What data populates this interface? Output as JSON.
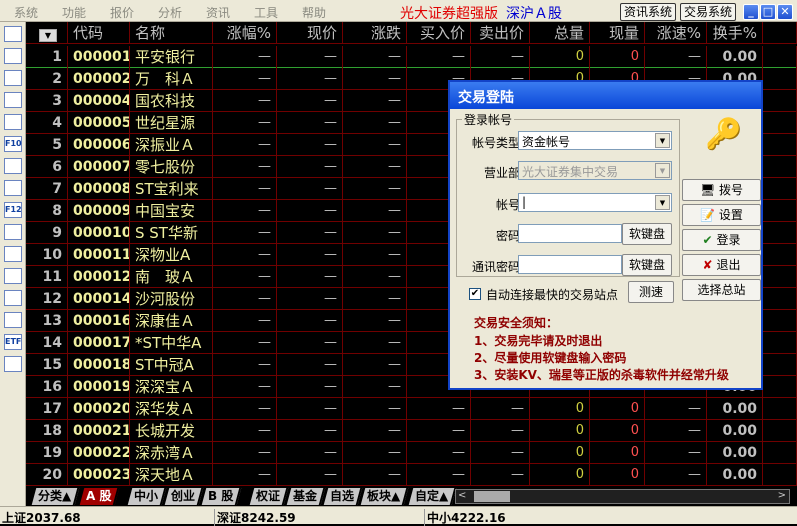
{
  "menu": [
    "系统",
    "功能",
    "报价",
    "分析",
    "资讯",
    "工具",
    "帮助"
  ],
  "title": "光大证券超强版",
  "market": "深沪Ａ股",
  "buttons": {
    "info": "资讯系统",
    "trade": "交易系统"
  },
  "headers": [
    "代码",
    "名称",
    "涨幅%",
    "现价",
    "涨跌",
    "买入价",
    "卖出价",
    "总量",
    "现量",
    "涨速%",
    "换手%"
  ],
  "dash": "—",
  "rows": [
    [
      "1",
      "000001",
      "平安银行"
    ],
    [
      "2",
      "000002",
      "万　科Ａ"
    ],
    [
      "3",
      "000004",
      "国农科技"
    ],
    [
      "4",
      "000005",
      "世纪星源"
    ],
    [
      "5",
      "000006",
      "深振业Ａ"
    ],
    [
      "6",
      "000007",
      "零七股份"
    ],
    [
      "7",
      "000008",
      "ST宝利来"
    ],
    [
      "8",
      "000009",
      "中国宝安"
    ],
    [
      "9",
      "000010",
      "S ST华新"
    ],
    [
      "10",
      "000011",
      "深物业A"
    ],
    [
      "11",
      "000012",
      "南　玻Ａ"
    ],
    [
      "12",
      "000014",
      "沙河股份"
    ],
    [
      "13",
      "000016",
      "深康佳Ａ"
    ],
    [
      "14",
      "000017",
      "*ST中华A"
    ],
    [
      "15",
      "000018",
      "ST中冠A"
    ],
    [
      "16",
      "000019",
      "深深宝Ａ"
    ],
    [
      "17",
      "000020",
      "深华发Ａ"
    ],
    [
      "18",
      "000021",
      "长城开发"
    ],
    [
      "19",
      "000022",
      "深赤湾Ａ"
    ],
    [
      "20",
      "000023",
      "深天地Ａ"
    ]
  ],
  "zero": "0",
  "turnover": "0.00",
  "tabs": [
    "分类▲",
    "A 股",
    "中小",
    "创业",
    "B 股",
    "权证",
    "基金",
    "自选",
    "板块▲",
    "自定▲"
  ],
  "status": {
    "sh": "上证2037.68",
    "sz": "深证8242.59",
    "zx": "中小4222.16"
  },
  "dialog": {
    "title": "交易登陆",
    "group": "登录帐号",
    "account_type_label": "帐号类型：",
    "account_type": "资金帐号",
    "branch_label": "营业部：",
    "branch": "光大证券集中交易",
    "account_label": "帐号：",
    "account": "",
    "password_label": "密码：",
    "comm_password_label": "通讯密码：",
    "softkbd": "软键盘",
    "auto_connect": "自动连接最快的交易站点",
    "auto_checked": true,
    "speedtest": "测速",
    "dial": "拨号",
    "settings": "设置",
    "login": "登录",
    "exit": "退出",
    "select_station": "选择总站",
    "notice_title": "交易安全须知：",
    "notices": [
      "1、交易完毕请及时退出",
      "2、尽量使用软键盘输入密码",
      "3、安装KV、瑞星等正版的杀毒软件并经常升级"
    ]
  }
}
